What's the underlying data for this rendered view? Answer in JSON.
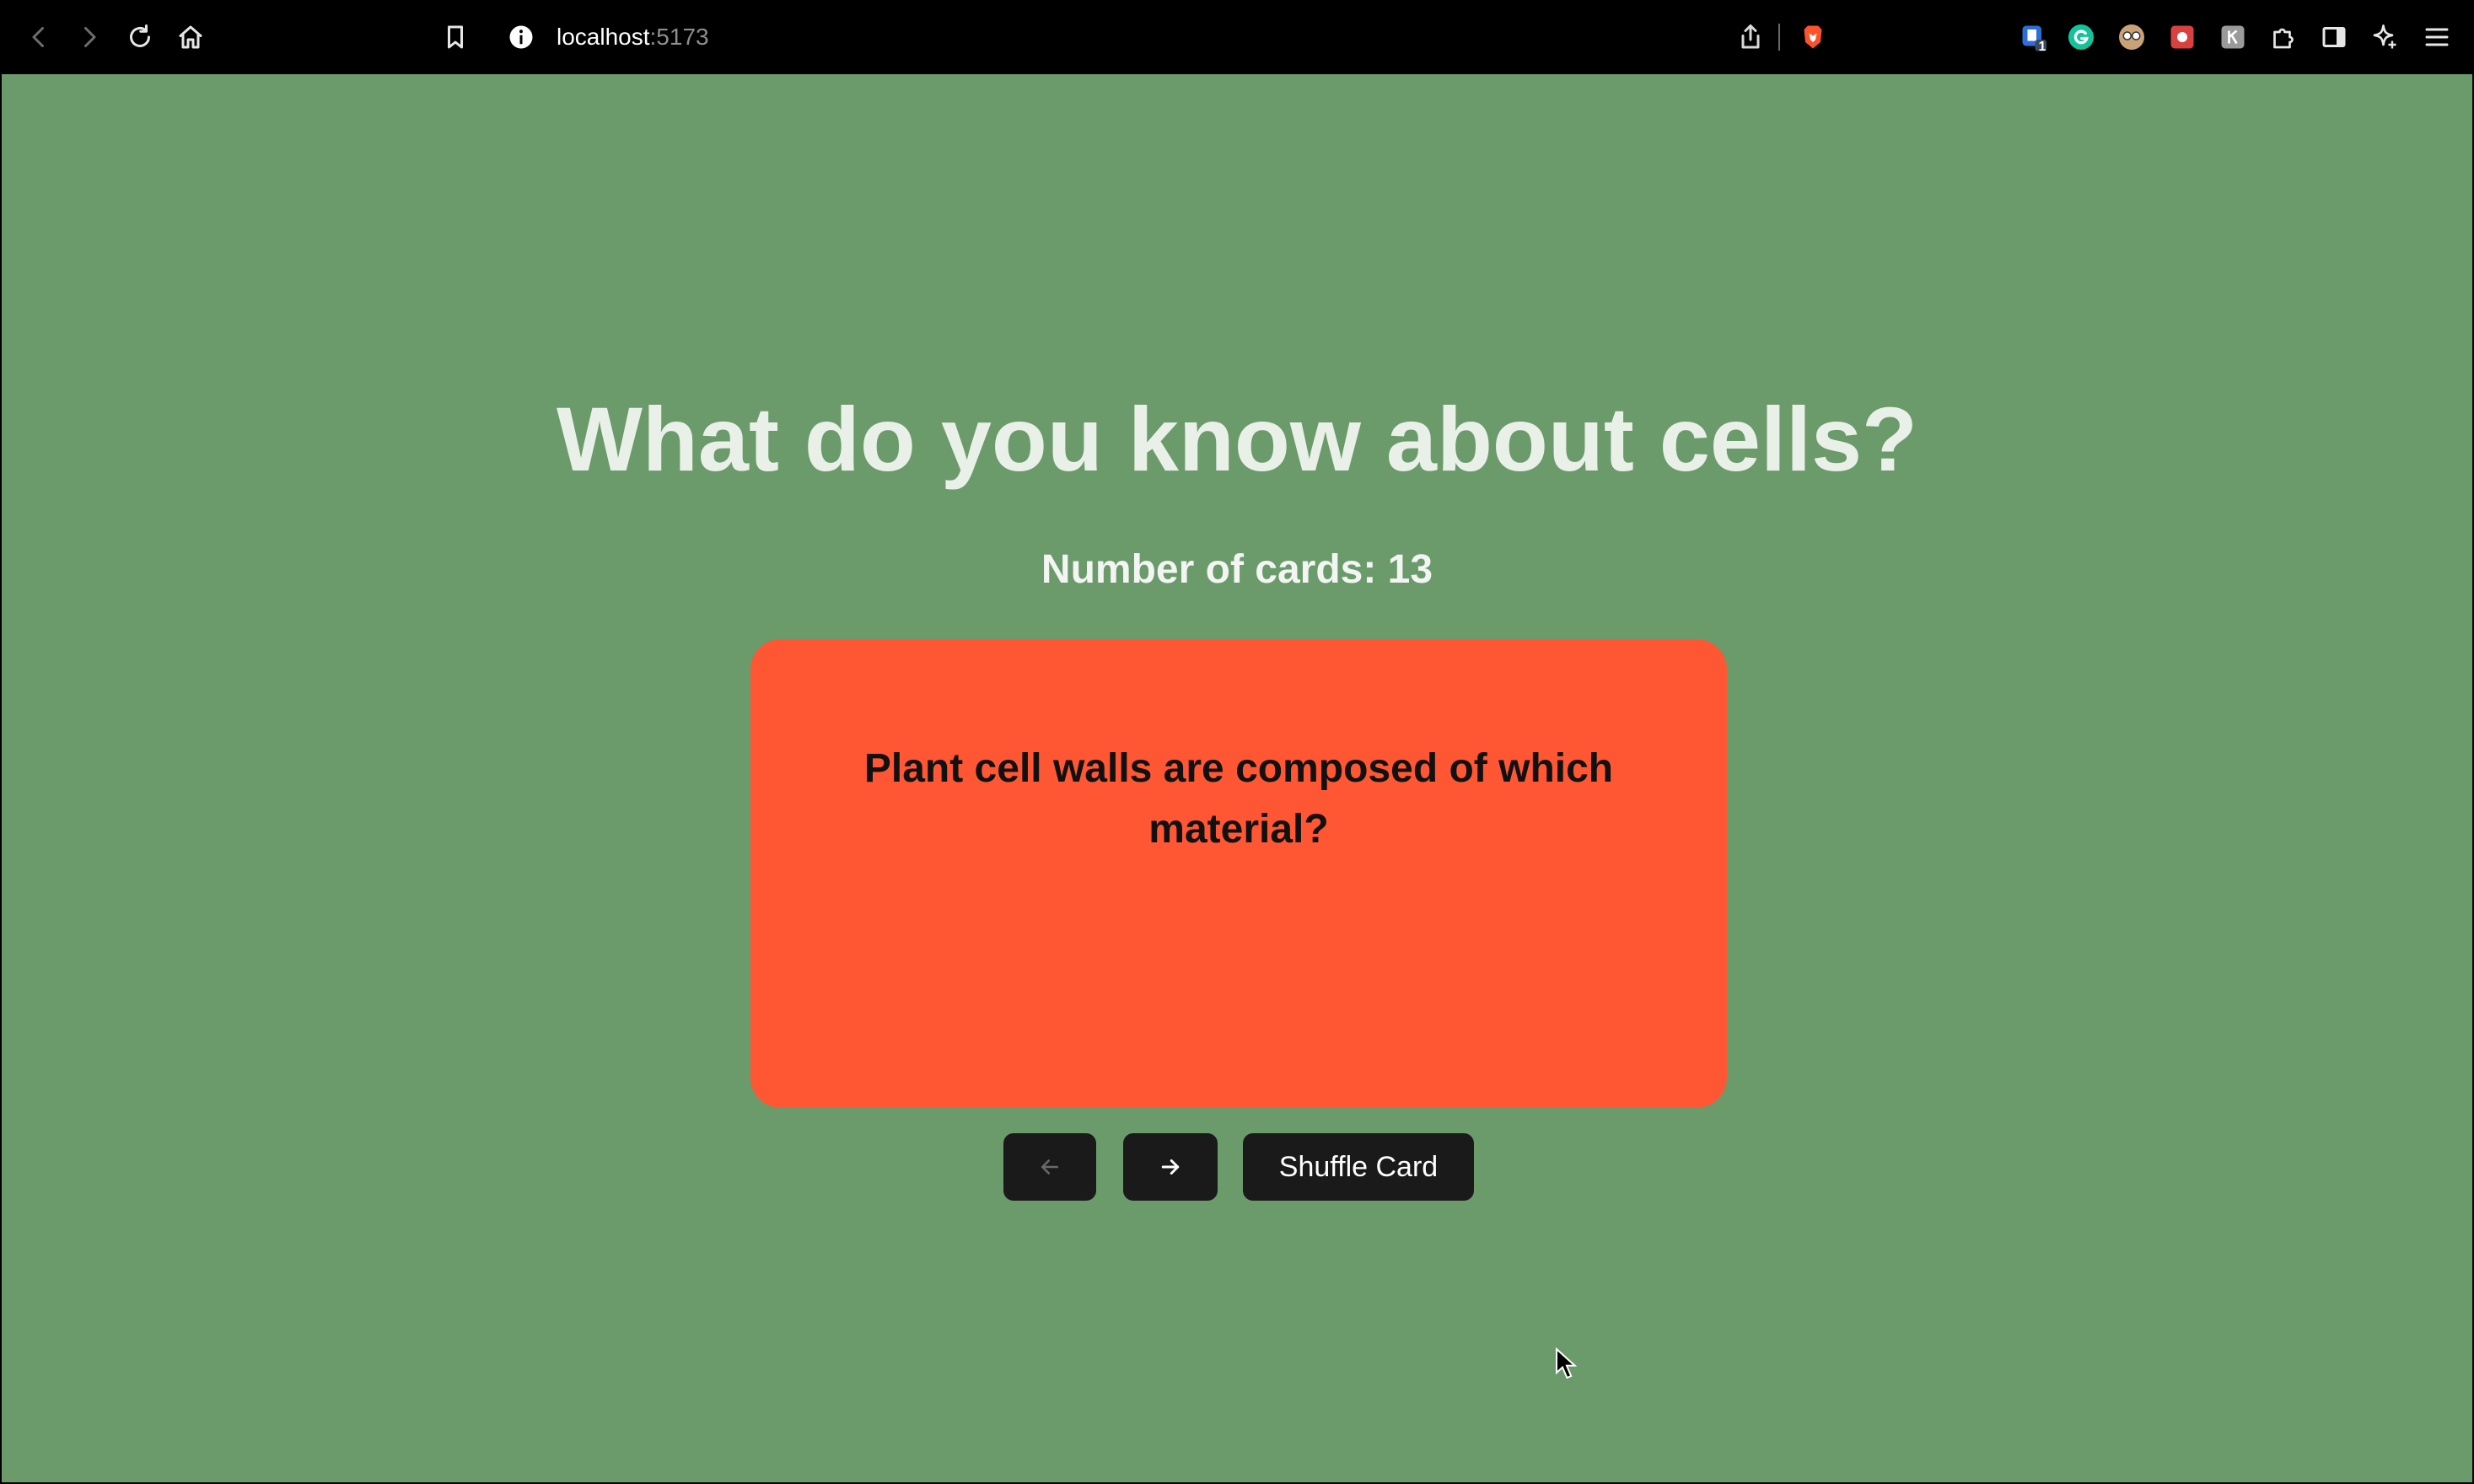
{
  "browser": {
    "url_host": "localhost",
    "url_port": ":5173",
    "icons": [
      "back-icon",
      "forward-icon",
      "reload-icon",
      "home-icon",
      "bookmark-icon",
      "site-info-icon",
      "share-icon",
      "brave-shield-icon",
      "extension-badge-icon",
      "grammarly-icon",
      "extension-avatar-icon",
      "extension-red-icon",
      "extension-grey-icon",
      "extensions-puzzle-icon",
      "sidebar-icon",
      "leo-ai-icon",
      "menu-icon"
    ],
    "extension_badge_count": "1"
  },
  "app": {
    "title": "What do you know about cells?",
    "card_count_label": "Number of cards: 13",
    "card": {
      "question": "Plant cell walls are composed of which material?"
    },
    "buttons": {
      "prev_icon": "arrow-left-icon",
      "next_icon": "arrow-right-icon",
      "shuffle_label": "Shuffle Card"
    }
  },
  "colors": {
    "background": "#6b9a6b",
    "card": "#ff5733",
    "button": "#1a1a1a",
    "title_text": "#e9f0e8"
  }
}
